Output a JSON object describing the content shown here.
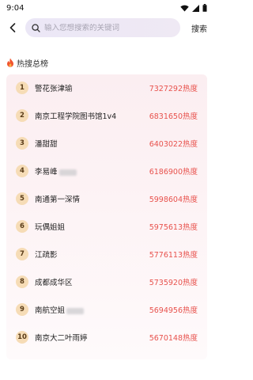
{
  "status_bar": {
    "time": "9:04"
  },
  "search": {
    "placeholder": "输入您想搜索的关键词",
    "button_label": "搜索"
  },
  "section": {
    "title": "热搜总榜"
  },
  "rankings": [
    {
      "rank": "1",
      "title": "警花张津瑜",
      "score": "7327292热度"
    },
    {
      "rank": "2",
      "title": "南京工程学院图书馆1v4",
      "score": "6831650热度"
    },
    {
      "rank": "3",
      "title": "潘甜甜",
      "score": "6403022热度"
    },
    {
      "rank": "4",
      "title": "李易峰",
      "score": "6186900热度"
    },
    {
      "rank": "5",
      "title": "南通第一深情",
      "score": "5998604热度"
    },
    {
      "rank": "6",
      "title": "玩偶姐姐",
      "score": "5975613热度"
    },
    {
      "rank": "7",
      "title": "江疏影",
      "score": "5776113热度"
    },
    {
      "rank": "8",
      "title": "成都成华区",
      "score": "5735920热度"
    },
    {
      "rank": "9",
      "title": "南航空姐",
      "score": "5694956热度"
    },
    {
      "rank": "10",
      "title": "南京大二叶雨婷",
      "score": "5670148热度"
    }
  ],
  "colors": {
    "score": "#e8524d",
    "badge_bg": "#f6dcb6",
    "card_bg": "#fbeef1",
    "search_bg": "#ebe7f6"
  }
}
